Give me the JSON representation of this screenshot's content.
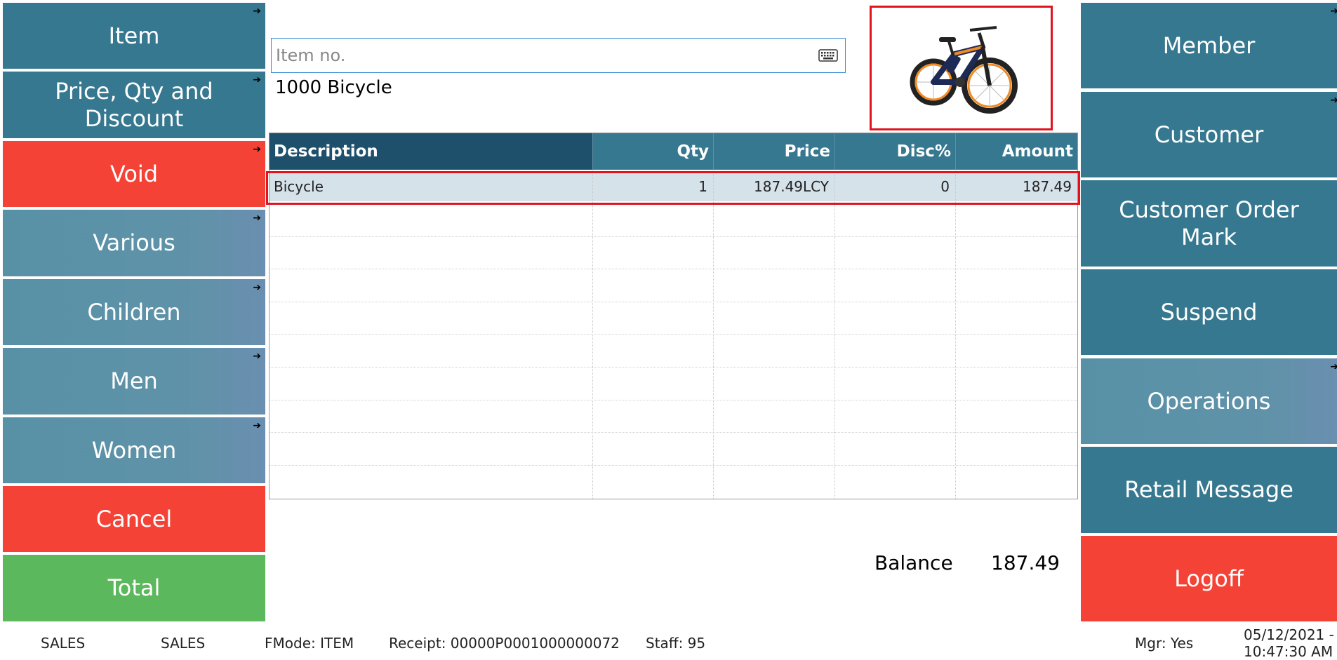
{
  "left_menu": [
    {
      "label": "Item",
      "has_submenu": true,
      "color": "dark"
    },
    {
      "label": "Price, Qty and Discount",
      "has_submenu": true,
      "color": "dark"
    },
    {
      "label": "Void",
      "has_submenu": true,
      "color": "red"
    },
    {
      "label": "Various",
      "has_submenu": true,
      "color": "light"
    },
    {
      "label": "Children",
      "has_submenu": true,
      "color": "light"
    },
    {
      "label": "Men",
      "has_submenu": true,
      "color": "light"
    },
    {
      "label": "Women",
      "has_submenu": true,
      "color": "light"
    },
    {
      "label": "Cancel",
      "has_submenu": false,
      "color": "red"
    },
    {
      "label": "Total",
      "has_submenu": false,
      "color": "green"
    }
  ],
  "right_menu": [
    {
      "label": "Member",
      "has_submenu": true,
      "color": "dark"
    },
    {
      "label": "Customer",
      "has_submenu": true,
      "color": "dark"
    },
    {
      "label": "Customer Order Mark",
      "has_submenu": false,
      "color": "dark"
    },
    {
      "label": "Suspend",
      "has_submenu": false,
      "color": "dark"
    },
    {
      "label": "Operations",
      "has_submenu": true,
      "color": "light"
    },
    {
      "label": "Retail Message",
      "has_submenu": false,
      "color": "dark"
    },
    {
      "label": "Logoff",
      "has_submenu": false,
      "color": "red"
    }
  ],
  "search": {
    "placeholder": "Item no.",
    "value": ""
  },
  "item_caption": "1000 Bicycle",
  "product_image": {
    "icon": "bicycle-image"
  },
  "table": {
    "headers": [
      "Description",
      "Qty",
      "Price",
      "Disc%",
      "Amount"
    ],
    "rows": [
      {
        "description": "Bicycle",
        "qty": "1",
        "price": "187.49LCY",
        "disc": "0",
        "amount": "187.49"
      }
    ]
  },
  "balance": {
    "label": "Balance",
    "value": "187.49"
  },
  "status_bar": {
    "s1": "SALES",
    "s2": "SALES",
    "fmode": "FMode: ITEM",
    "receipt": "Receipt: 00000P0001000000072",
    "staff": "Staff: 95",
    "mgr": "Mgr: Yes",
    "date": "05/12/2021 -",
    "time": "10:47:30 AM"
  },
  "colors": {
    "dark": "#36788f",
    "light": "#5f92a8",
    "red": "#f44336",
    "green": "#5cb85c",
    "header_dark": "#1e4f6b",
    "highlight": "#e0131e"
  }
}
